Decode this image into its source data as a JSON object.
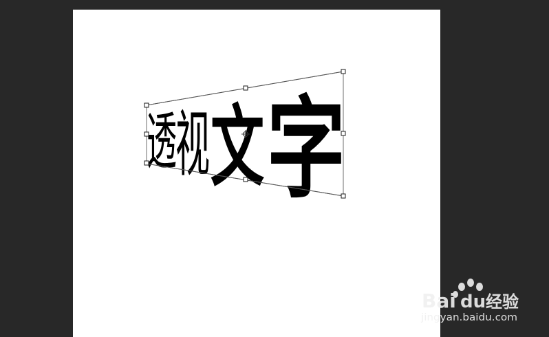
{
  "canvas": {
    "text_layer": {
      "chars": [
        "透",
        "视",
        "文",
        "字"
      ],
      "text_color": "#000000",
      "transform_mode": "perspective"
    },
    "transform_box": {
      "frame_color": "#6e6e6e",
      "handle_fill": "#ffffff",
      "handle_stroke": "#1a1a1a",
      "handle_icons": [
        "corner-handle-icon",
        "edge-handle-icon",
        "center-pivot-icon"
      ]
    }
  },
  "workspace": {
    "background_color": "#282828",
    "canvas_color": "#ffffff"
  },
  "watermark": {
    "logo_text": "Bai",
    "logo_text_2": "du",
    "cn_text": "经验",
    "url": "jingyan.baidu.com",
    "color": "#f0f0f0"
  }
}
